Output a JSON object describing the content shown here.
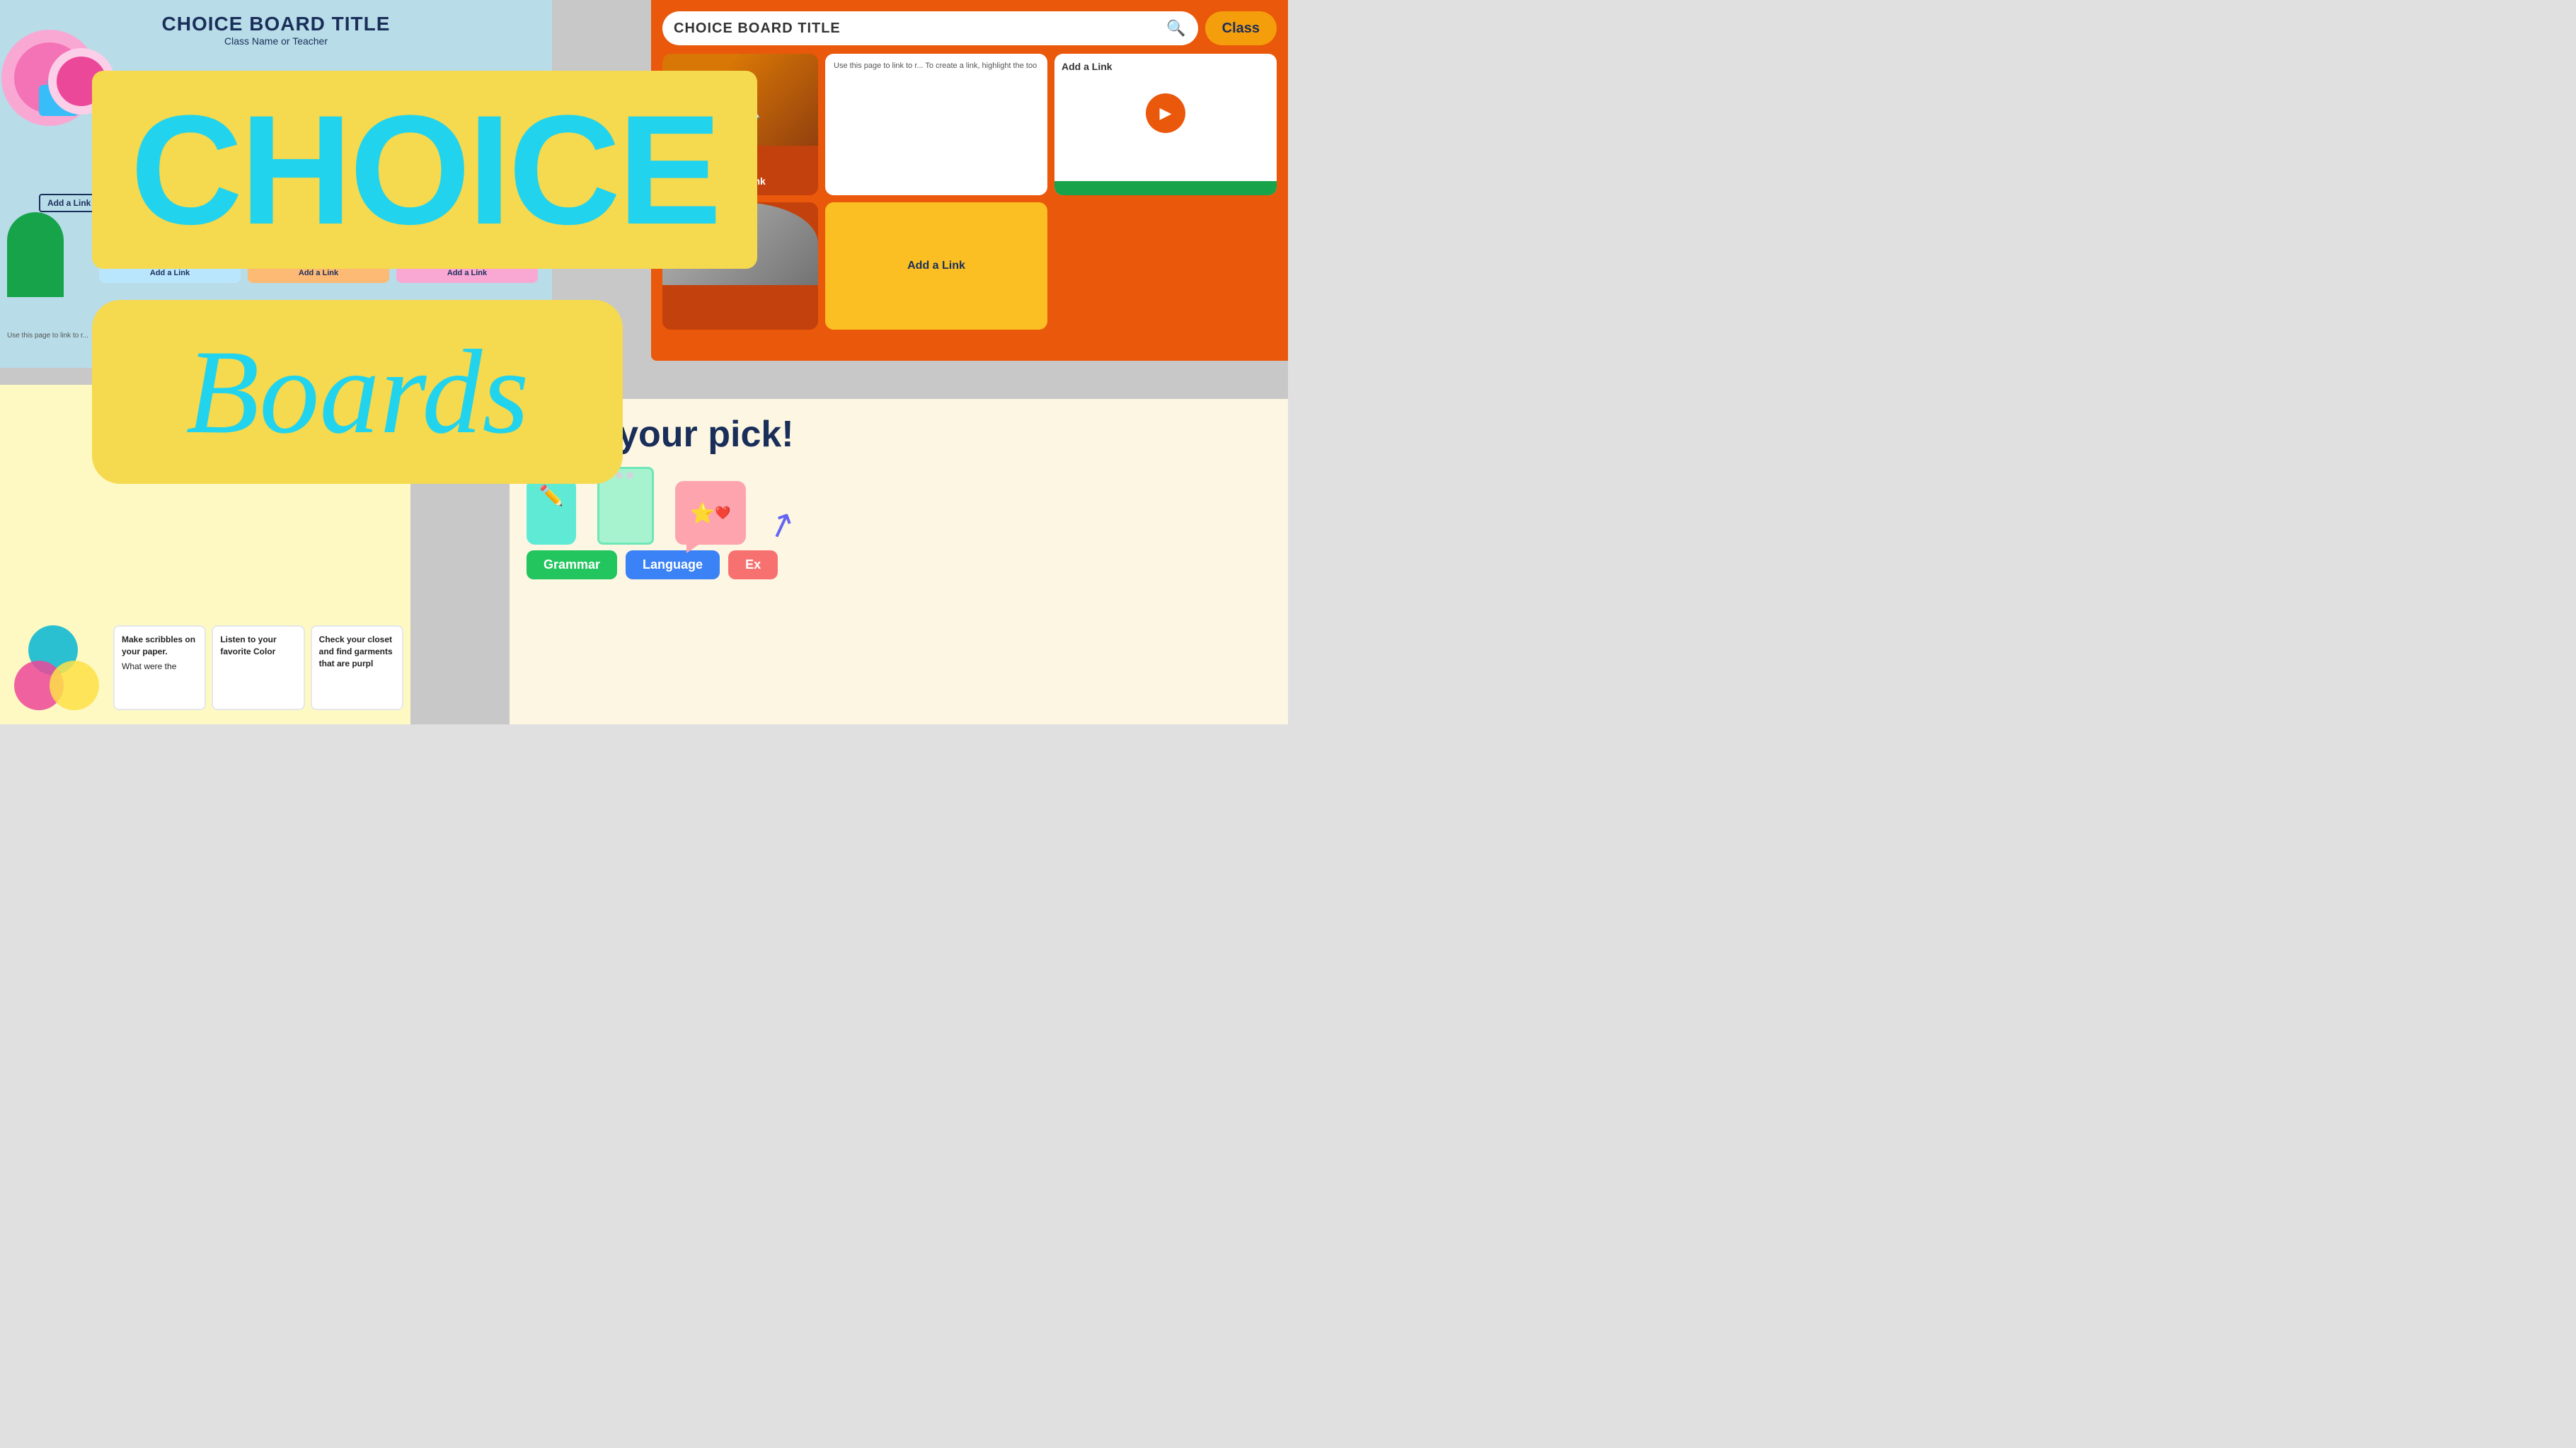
{
  "slides": {
    "topleft": {
      "title": "CHOICE BOARD TITLE",
      "subtitle": "Class Name or Teacher",
      "add_link": "Add a Link",
      "use_page_text": "Use this page to link to r...",
      "inner_cards": [
        {
          "label": "Add a Link",
          "color": "blue"
        },
        {
          "label": "Add a Link",
          "color": "orange"
        },
        {
          "label": "Add a Link",
          "color": "pink"
        }
      ]
    },
    "topright": {
      "search_placeholder": "CHOICE BOARD TITLE",
      "class_button": "Class",
      "add_link_label": "Add a Link",
      "use_page_text": "Use this page to link to r...\nTo create a link, highlight\nthe too"
    },
    "banner_choice": "CHOICE",
    "banner_boards": "Boards",
    "bottomleft": {
      "cards": [
        {
          "title": "Make scribbles on your paper.",
          "body": "What were the"
        },
        {
          "title": "Listen to your favorite Color",
          "body": ""
        },
        {
          "title": "Check your closet and find garments that are purpl",
          "body": ""
        }
      ]
    },
    "bottomright": {
      "title": "Take your pick!",
      "subjects": [
        {
          "label": "Grammar",
          "color": "green"
        },
        {
          "label": "Language",
          "color": "blue"
        },
        {
          "label": "Ex",
          "color": "salmon"
        }
      ]
    }
  },
  "icons": {
    "search": "🔍",
    "play": "▶",
    "pencils": "✏️",
    "star": "⭐",
    "heart": "❤️",
    "arrow": "↗"
  }
}
